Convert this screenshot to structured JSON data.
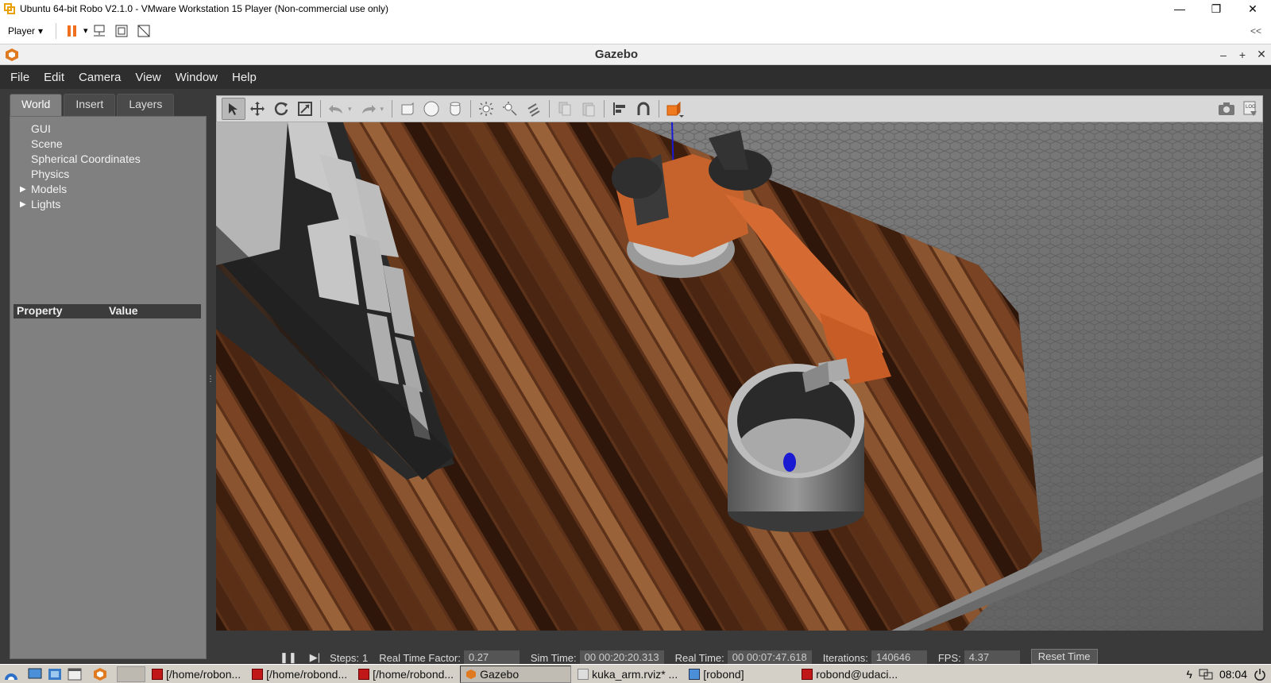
{
  "vm_window": {
    "title": "Ubuntu 64-bit Robo V2.1.0 - VMware Workstation 15 Player (Non-commercial use only)",
    "player_menu_label": "Player",
    "controls": {
      "minimize": "—",
      "restore": "❐",
      "close": "✕"
    },
    "collapse_label": "<<"
  },
  "gazebo": {
    "title": "Gazebo",
    "window_controls": {
      "minimize": "–",
      "maximize": "+",
      "close": "✕"
    },
    "menu": [
      "File",
      "Edit",
      "Camera",
      "View",
      "Window",
      "Help"
    ],
    "tabs": [
      "World",
      "Insert",
      "Layers"
    ],
    "active_tab": "World",
    "tree": [
      {
        "label": "GUI",
        "expandable": false
      },
      {
        "label": "Scene",
        "expandable": false
      },
      {
        "label": "Spherical Coordinates",
        "expandable": false
      },
      {
        "label": "Physics",
        "expandable": false
      },
      {
        "label": "Models",
        "expandable": true
      },
      {
        "label": "Lights",
        "expandable": true
      }
    ],
    "property_header": {
      "property": "Property",
      "value": "Value"
    },
    "toolbar_icons": [
      "select-icon",
      "translate-icon",
      "rotate-icon",
      "scale-icon",
      "undo-icon",
      "redo-icon",
      "box-icon",
      "sphere-icon",
      "cylinder-icon",
      "point-light-icon",
      "spot-light-icon",
      "directional-light-icon",
      "copy-icon",
      "paste-icon",
      "align-icon",
      "snap-icon",
      "view-angle-icon",
      "screenshot-icon",
      "log-icon"
    ],
    "bottom_bar": {
      "steps_label": "Steps:",
      "steps_value": "1",
      "rtf_label": "Real Time Factor:",
      "rtf_value": "0.27",
      "sim_time_label": "Sim Time:",
      "sim_time_value": "00 00:20:20.313",
      "real_time_label": "Real Time:",
      "real_time_value": "00 00:07:47.618",
      "iterations_label": "Iterations:",
      "iterations_value": "140646",
      "fps_label": "FPS:",
      "fps_value": "4.37",
      "reset_label": "Reset Time"
    }
  },
  "taskbar": {
    "tasks": [
      {
        "label": "[/home/robon...",
        "icon": "terminal-icon"
      },
      {
        "label": "[/home/robond...",
        "icon": "terminal-icon"
      },
      {
        "label": "[/home/robond...",
        "icon": "terminal-icon"
      },
      {
        "label": "Gazebo",
        "icon": "gazebo-icon"
      },
      {
        "label": "kuka_arm.rviz* ...",
        "icon": "rviz-icon"
      },
      {
        "label": "[robond]",
        "icon": "folder-icon"
      },
      {
        "label": "robond@udaci...",
        "icon": "terminal-icon"
      }
    ],
    "clock": "08:04"
  },
  "colors": {
    "gazebo_dark": "#2e2e2e",
    "panel_gray": "#808080",
    "robot_orange": "#d2622a",
    "floor_wood": "#6b3a1e",
    "target_blue": "#1010c8"
  }
}
